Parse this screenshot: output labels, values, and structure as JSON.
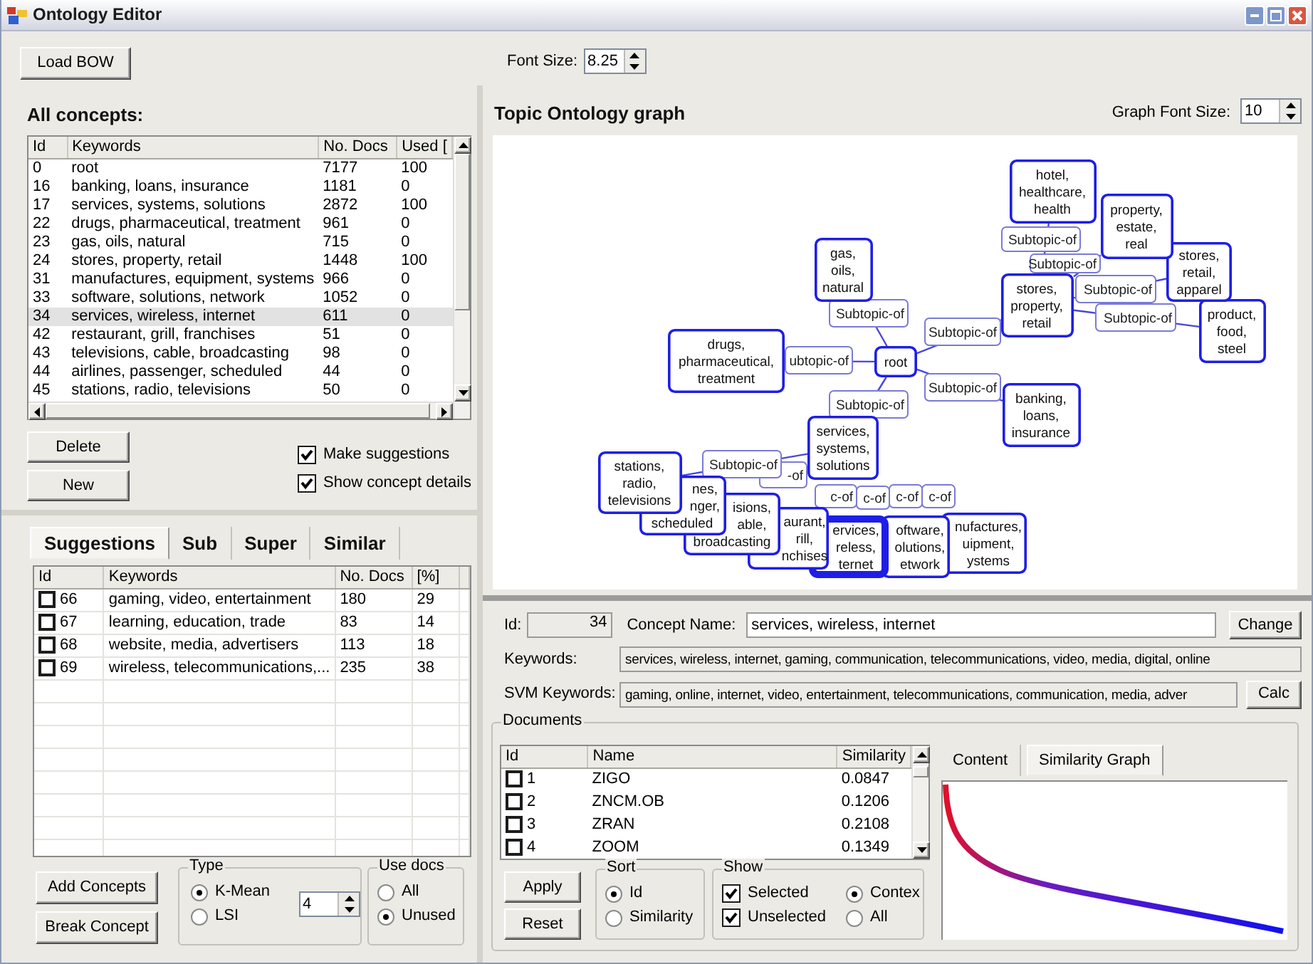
{
  "window": {
    "title": "Ontology Editor"
  },
  "toolbar": {
    "load_button": "Load BOW",
    "font_size_label": "Font Size:",
    "font_size": "8.25"
  },
  "concepts": {
    "heading": "All concepts:",
    "columns": [
      "Id",
      "Keywords",
      "No. Docs",
      "Used ["
    ],
    "rows": [
      {
        "id": "0",
        "keywords": "root",
        "docs": "7177",
        "used": "100",
        "selected": false
      },
      {
        "id": "16",
        "keywords": "banking, loans, insurance",
        "docs": "1181",
        "used": "0",
        "selected": false
      },
      {
        "id": "17",
        "keywords": "services, systems, solutions",
        "docs": "2872",
        "used": "100",
        "selected": false
      },
      {
        "id": "22",
        "keywords": "drugs, pharmaceutical, treatment",
        "docs": "961",
        "used": "0",
        "selected": false
      },
      {
        "id": "23",
        "keywords": "gas, oils, natural",
        "docs": "715",
        "used": "0",
        "selected": false
      },
      {
        "id": "24",
        "keywords": "stores, property, retail",
        "docs": "1448",
        "used": "100",
        "selected": false
      },
      {
        "id": "31",
        "keywords": "manufactures, equipment, systems",
        "docs": "966",
        "used": "0",
        "selected": false
      },
      {
        "id": "33",
        "keywords": "software, solutions, network",
        "docs": "1052",
        "used": "0",
        "selected": false
      },
      {
        "id": "34",
        "keywords": "services, wireless, internet",
        "docs": "611",
        "used": "0",
        "selected": true
      },
      {
        "id": "42",
        "keywords": "restaurant, grill, franchises",
        "docs": "51",
        "used": "0",
        "selected": false
      },
      {
        "id": "43",
        "keywords": "televisions, cable, broadcasting",
        "docs": "98",
        "used": "0",
        "selected": false
      },
      {
        "id": "44",
        "keywords": "airlines, passenger, scheduled",
        "docs": "44",
        "used": "0",
        "selected": false
      },
      {
        "id": "45",
        "keywords": "stations, radio, televisions",
        "docs": "50",
        "used": "0",
        "selected": false
      }
    ],
    "delete_button": "Delete",
    "new_button": "New",
    "options": [
      {
        "label": "Make suggestions",
        "checked": true
      },
      {
        "label": "Show concept details",
        "checked": true
      }
    ]
  },
  "suggestions": {
    "tabs": [
      {
        "label": "Suggestions",
        "selected": true
      },
      {
        "label": "Sub",
        "selected": false
      },
      {
        "label": "Super",
        "selected": false
      },
      {
        "label": "Similar",
        "selected": false
      }
    ],
    "columns": [
      "Id",
      "Keywords",
      "No. Docs",
      "[%]"
    ],
    "rows": [
      {
        "id": "66",
        "keywords": "gaming, video, entertainment",
        "docs": "180",
        "percent": "29",
        "checked": false
      },
      {
        "id": "67",
        "keywords": "learning, education, trade",
        "docs": "83",
        "percent": "14",
        "checked": false
      },
      {
        "id": "68",
        "keywords": "website, media, advertisers",
        "docs": "113",
        "percent": "18",
        "checked": false
      },
      {
        "id": "69",
        "keywords": "wireless, telecommunications,...",
        "docs": "235",
        "percent": "38",
        "checked": false
      }
    ],
    "add_button": "Add Concepts",
    "break_button": "Break Concept",
    "type_group": {
      "title": "Type",
      "options": [
        {
          "label": "K-Mean",
          "selected": true
        },
        {
          "label": "LSI",
          "selected": false
        }
      ],
      "count": "4"
    },
    "use_docs": {
      "title": "Use docs",
      "options": [
        {
          "label": "All",
          "selected": false
        },
        {
          "label": "Unused",
          "selected": true
        }
      ]
    }
  },
  "graph": {
    "title": "Topic Ontology graph",
    "font_size_label": "Graph Font Size:",
    "font_size": "10",
    "edge_labels": [
      "Subtopic-of",
      "Subtopic-of",
      "ubtopic-of",
      "Subtopic-of",
      "Subtopic-of",
      "Subtopic-of",
      "Subtopic-of",
      "Subtopic-of",
      "Subtopic-of",
      "Subtopic-of",
      "-of",
      "c-of",
      "c-of",
      "c-of",
      "c-of"
    ],
    "nodes": [
      {
        "label": "hotel, healthcare, health",
        "selected": false
      },
      {
        "label": "property, estate, real",
        "selected": false
      },
      {
        "label": "gas, oils, natural",
        "selected": false
      },
      {
        "label": "stores, retail, apparel",
        "selected": false
      },
      {
        "label": "stores, property, retail",
        "selected": false
      },
      {
        "label": "product, food, steel",
        "selected": false
      },
      {
        "label": "drugs, pharmaceutical, treatment",
        "selected": false
      },
      {
        "label": "root",
        "selected": false
      },
      {
        "label": "banking, loans, insurance",
        "selected": false
      },
      {
        "label": "services, systems, solutions",
        "selected": false
      },
      {
        "label": "stations, radio, televisions",
        "selected": false
      },
      {
        "label": "nes, nger, scheduled",
        "selected": false
      },
      {
        "label": "isions, able, broadcasting",
        "selected": false
      },
      {
        "label": "aurant, rill, nchises",
        "selected": false
      },
      {
        "label": "ervices, reless, ternet",
        "selected": true
      },
      {
        "label": "oftware, olutions, etwork",
        "selected": false
      },
      {
        "label": "nufactures, uipment, ystems",
        "selected": false
      }
    ]
  },
  "details": {
    "id_label": "Id:",
    "id": "34",
    "name_label": "Concept Name:",
    "name": "services, wireless, internet",
    "change_button": "Change",
    "keywords_label": "Keywords:",
    "keywords": "services, wireless, internet, gaming, communication, telecommunications, video, media, digital, online",
    "svm_label": "SVM Keywords:",
    "svm_keywords": "gaming, online, internet, video, entertainment, telecommunications, communication, media, adver",
    "calc_button": "Calc"
  },
  "documents": {
    "title": "Documents",
    "columns": [
      "Id",
      "Name",
      "Similarity"
    ],
    "rows": [
      {
        "id": "1",
        "name": "ZIGO",
        "similarity": "0.0847",
        "checked": false
      },
      {
        "id": "2",
        "name": "ZNCM.OB",
        "similarity": "0.1206",
        "checked": false
      },
      {
        "id": "3",
        "name": "ZRAN",
        "similarity": "0.2108",
        "checked": false
      },
      {
        "id": "4",
        "name": "ZOOM",
        "similarity": "0.1349",
        "checked": false
      }
    ],
    "apply_button": "Apply",
    "reset_button": "Reset",
    "sort": {
      "title": "Sort",
      "options": [
        {
          "label": "Id",
          "selected": true
        },
        {
          "label": "Similarity",
          "selected": false
        }
      ]
    },
    "show": {
      "title": "Show",
      "checks": [
        {
          "label": "Selected",
          "checked": true
        },
        {
          "label": "Unselected",
          "checked": true
        }
      ],
      "radios": [
        {
          "label": "Contex",
          "selected": true
        },
        {
          "label": "All",
          "selected": false
        }
      ]
    },
    "tabs": [
      {
        "label": "Content",
        "selected": false
      },
      {
        "label": "Similarity Graph",
        "selected": true
      }
    ]
  }
}
